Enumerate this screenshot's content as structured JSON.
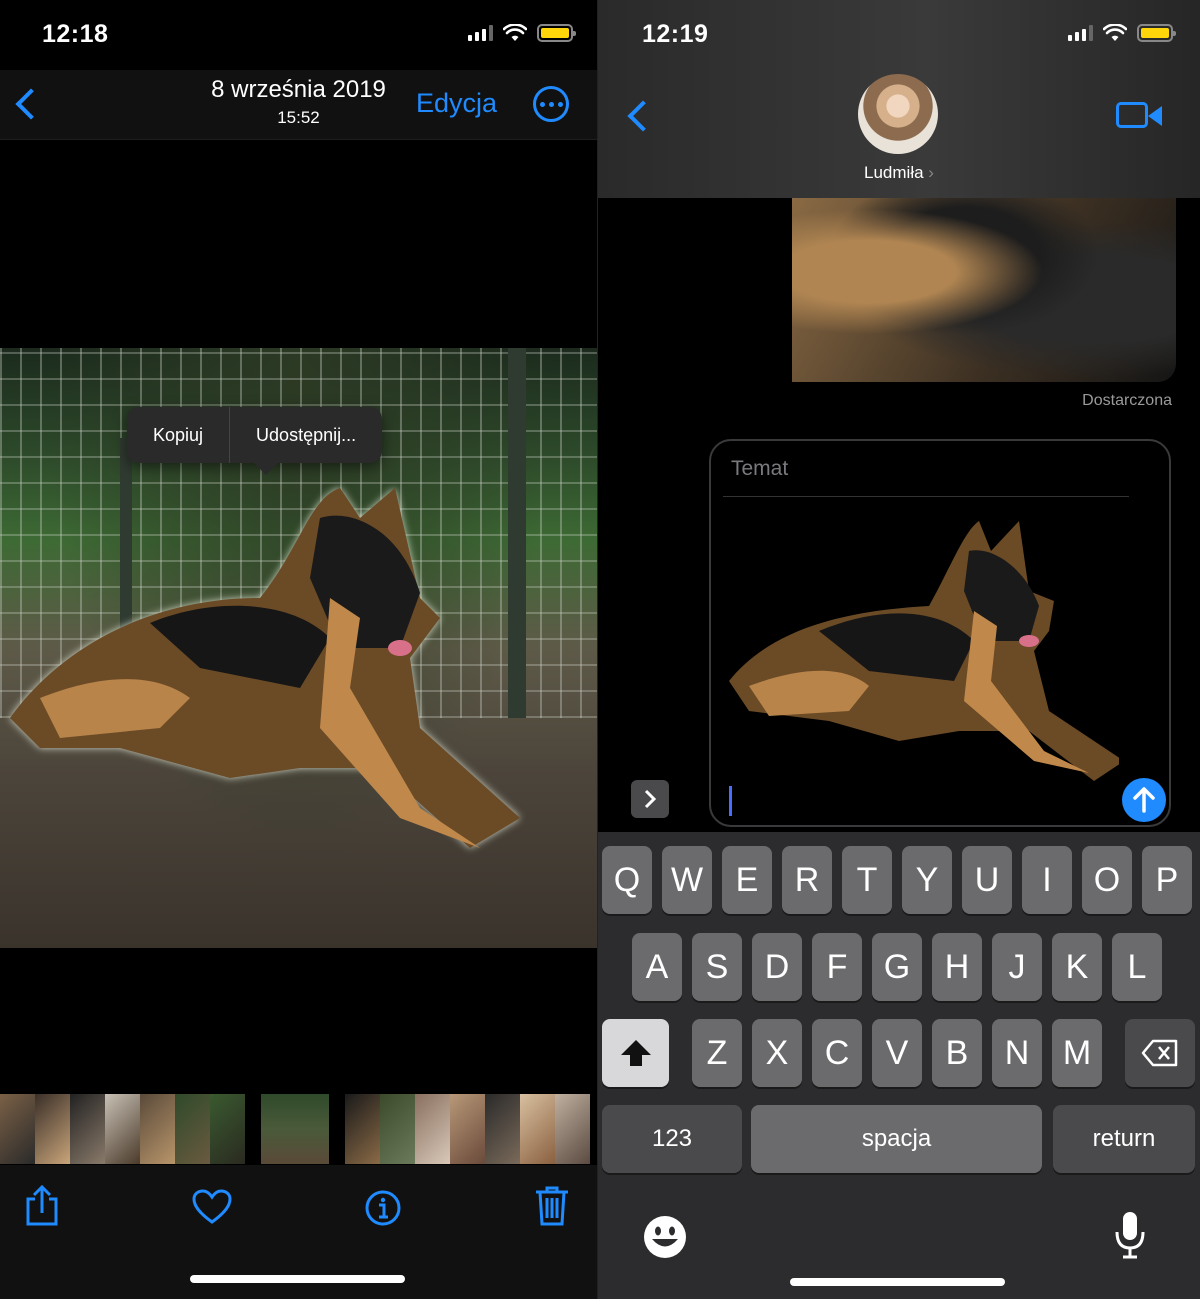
{
  "left": {
    "status": {
      "time": "12:18"
    },
    "nav": {
      "title": "8 września 2019",
      "subtitle": "15:52",
      "edit_label": "Edycja"
    },
    "context_menu": {
      "copy": "Kopiuj",
      "share": "Udostępnij..."
    },
    "toolbar": {
      "icons": [
        "share-icon",
        "heart-icon",
        "info-icon",
        "trash-icon"
      ]
    }
  },
  "right": {
    "status": {
      "time": "12:19"
    },
    "contact": {
      "name": "Ludmiła",
      "chevron": "›"
    },
    "delivered": "Dostarczona",
    "compose": {
      "subject_placeholder": "Temat"
    },
    "keyboard": {
      "row1": [
        "Q",
        "W",
        "E",
        "R",
        "T",
        "Y",
        "U",
        "I",
        "O",
        "P"
      ],
      "row2": [
        "A",
        "S",
        "D",
        "F",
        "G",
        "H",
        "J",
        "K",
        "L"
      ],
      "row3": [
        "Z",
        "X",
        "C",
        "V",
        "B",
        "N",
        "M"
      ],
      "numbers": "123",
      "space": "spacja",
      "return": "return"
    }
  },
  "colors": {
    "accent": "#1f8bff",
    "battery": "#ffd60a",
    "key": "#6b6b6e",
    "keyboard_bg": "#2c2c2e"
  }
}
